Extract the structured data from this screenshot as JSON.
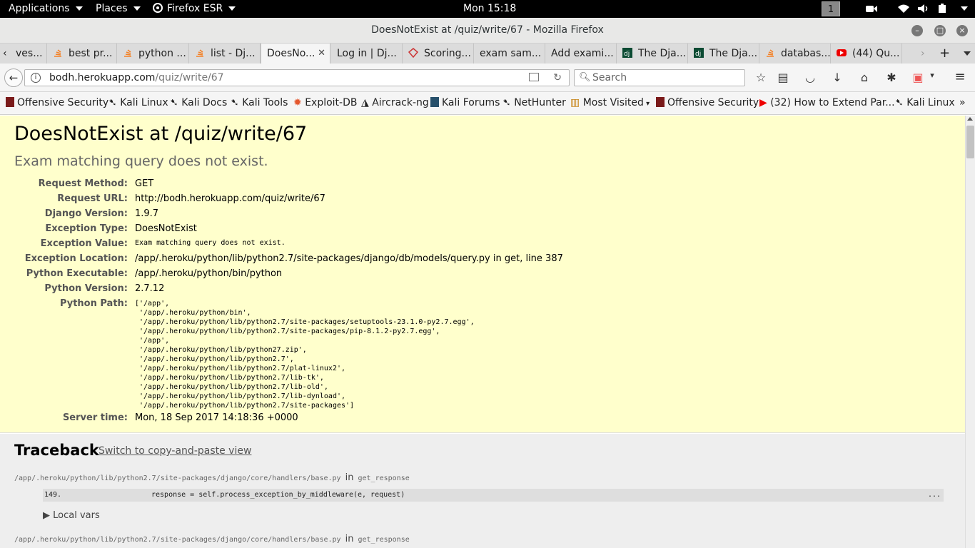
{
  "topbar": {
    "applications": "Applications",
    "places": "Places",
    "browser": "Firefox ESR",
    "clock": "Mon 15:18",
    "workspace": "1"
  },
  "window": {
    "title": "DoesNotExist at /quiz/write/67 - Mozilla Firefox"
  },
  "tabs": [
    {
      "label": "ves...",
      "icon": "partial"
    },
    {
      "label": "best pr...",
      "icon": "stackoverflow"
    },
    {
      "label": "python ...",
      "icon": "stackoverflow"
    },
    {
      "label": "list - Dj...",
      "icon": "stackoverflow"
    },
    {
      "label": "DoesNo...",
      "icon": "none",
      "active": true
    },
    {
      "label": "Log in | Dj...",
      "icon": "none"
    },
    {
      "label": "Scoring...",
      "icon": "ruby"
    },
    {
      "label": "exam sam...",
      "icon": "none"
    },
    {
      "label": "Add exami...",
      "icon": "none"
    },
    {
      "label": "The Dja...",
      "icon": "django"
    },
    {
      "label": "The Dja...",
      "icon": "django"
    },
    {
      "label": "databas...",
      "icon": "stackoverflow"
    },
    {
      "label": "(44) Qu...",
      "icon": "youtube"
    }
  ],
  "nav": {
    "url_host": "bodh.herokuapp.com",
    "url_path": "/quiz/write/67",
    "search_placeholder": "Search"
  },
  "bookmarks": [
    "Offensive Security",
    "Kali Linux",
    "Kali Docs",
    "Kali Tools",
    "Exploit-DB",
    "Aircrack-ng",
    "Kali Forums",
    "NetHunter",
    "Most Visited",
    "Offensive Security",
    "(32) How to Extend Par...",
    "Kali Linux"
  ],
  "error": {
    "title": "DoesNotExist at /quiz/write/67",
    "subtitle": "Exam matching query does not exist.",
    "meta": [
      {
        "label": "Request Method:",
        "value": "GET"
      },
      {
        "label": "Request URL:",
        "value": "http://bodh.herokuapp.com/quiz/write/67"
      },
      {
        "label": "Django Version:",
        "value": "1.9.7"
      },
      {
        "label": "Exception Type:",
        "value": "DoesNotExist"
      },
      {
        "label": "Exception Value:",
        "value": "Exam matching query does not exist."
      },
      {
        "label": "Exception Location:",
        "value": "/app/.heroku/python/lib/python2.7/site-packages/django/db/models/query.py in get, line 387"
      },
      {
        "label": "Python Executable:",
        "value": "/app/.heroku/python/bin/python"
      },
      {
        "label": "Python Version:",
        "value": "2.7.12"
      },
      {
        "label": "Python Path:",
        "value": "['/app',\n '/app/.heroku/python/bin',\n '/app/.heroku/python/lib/python2.7/site-packages/setuptools-23.1.0-py2.7.egg',\n '/app/.heroku/python/lib/python2.7/site-packages/pip-8.1.2-py2.7.egg',\n '/app',\n '/app/.heroku/python/lib/python27.zip',\n '/app/.heroku/python/lib/python2.7',\n '/app/.heroku/python/lib/python2.7/plat-linux2',\n '/app/.heroku/python/lib/python2.7/lib-tk',\n '/app/.heroku/python/lib/python2.7/lib-old',\n '/app/.heroku/python/lib/python2.7/lib-dynload',\n '/app/.heroku/python/lib/python2.7/site-packages']"
      },
      {
        "label": "Server time:",
        "value": "Mon, 18 Sep 2017 14:18:36 +0000"
      }
    ]
  },
  "traceback": {
    "title": "Traceback",
    "switch_link": "Switch to copy-and-paste view",
    "frames": [
      {
        "file": "/app/.heroku/python/lib/python2.7/site-packages/django/core/handlers/base.py",
        "in": "in",
        "func": "get_response"
      },
      {
        "file": "/app/.heroku/python/lib/python2.7/site-packages/django/core/handlers/base.py",
        "in": "in",
        "func": "get_response"
      }
    ],
    "code_line_num": "149.",
    "code_line": "response = self.process_exception_by_middleware(e, request)",
    "code_dots": "...",
    "local_vars": "▶ Local vars"
  },
  "colors": {
    "summary_bg": "#ffffcc",
    "traceback_bg": "#eeeeee",
    "topbar_bg": "#000000"
  }
}
